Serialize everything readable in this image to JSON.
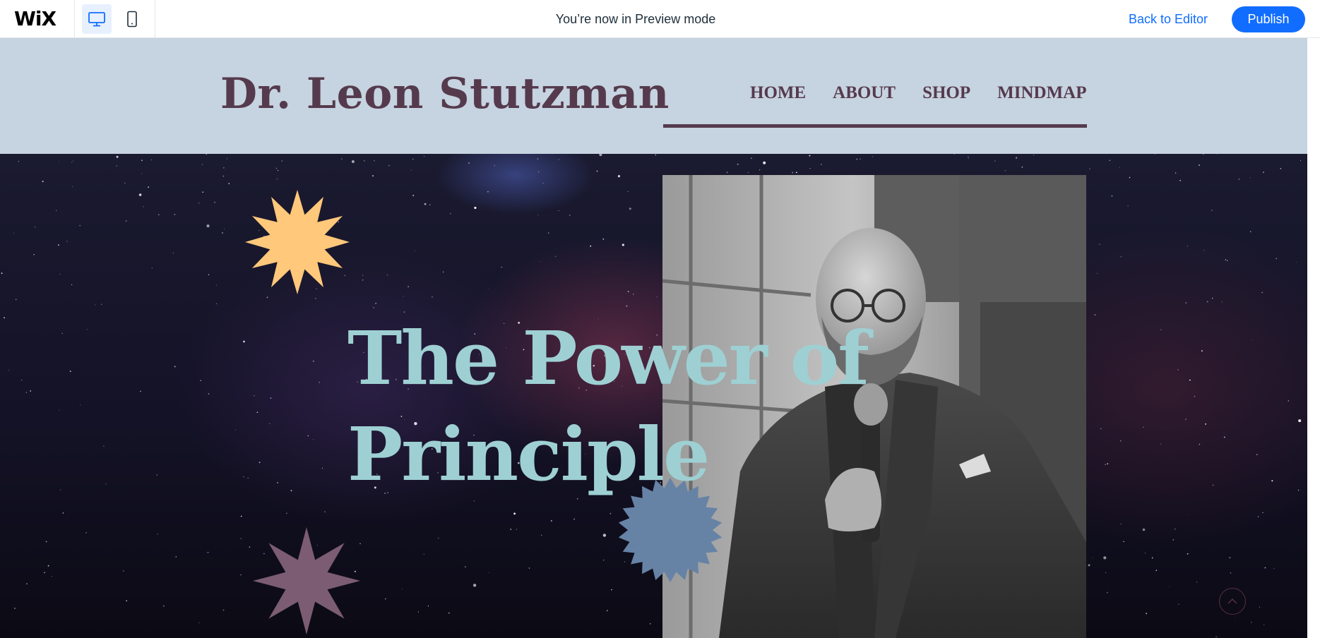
{
  "topbar": {
    "logo": "WiX",
    "devices": [
      {
        "name": "desktop",
        "icon": "desktop-icon",
        "active": true
      },
      {
        "name": "mobile",
        "icon": "mobile-icon",
        "active": false
      }
    ],
    "preview_message": "You’re now in Preview mode",
    "back_to_editor": "Back to Editor",
    "publish": "Publish"
  },
  "site": {
    "title": "Dr. Leon Stutzman",
    "nav": [
      {
        "label": "HOME"
      },
      {
        "label": "ABOUT"
      },
      {
        "label": "SHOP"
      },
      {
        "label": "MINDMAP"
      }
    ]
  },
  "hero": {
    "title_line1": "The Power of",
    "title_line2": "Principle",
    "portrait_icon": "portrait-photo",
    "scroll_icon": "chevron-up-icon"
  },
  "colors": {
    "wix_blue": "#116dff",
    "header_bg": "#c6d3e0",
    "brand_plum": "#553a4d",
    "hero_title": "#9ed0d3",
    "burst_yellow": "#ffc87a",
    "burst_blue": "#6683a6",
    "burst_mauve": "#7b5c72"
  }
}
